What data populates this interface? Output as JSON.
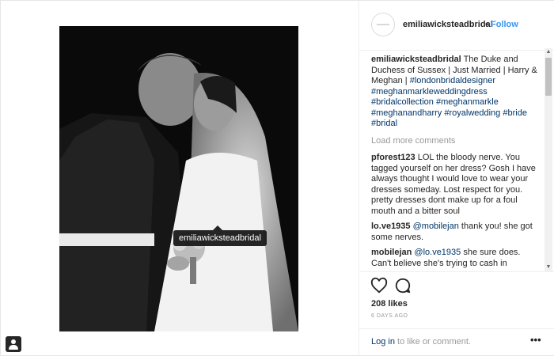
{
  "post": {
    "tag_label": "emiliawicksteadbridal",
    "username": "emiliawicksteadbridal",
    "follow_label": "Follow",
    "dot": "•",
    "caption": {
      "user": "emiliawicksteadbridal",
      "text": " The Duke and Duchess of Sussex | Just Married | Harry & Meghan | ",
      "hashtags": [
        "#londonbridaldesigner",
        "#meghanmarkleweddingdress",
        "#bridalcollection",
        "#meghanmarkle",
        "#meghanandharry",
        "#royalwedding",
        "#bride",
        "#bridal"
      ]
    },
    "load_more": "Load more comments",
    "comments": [
      {
        "user": "pforest123",
        "text": " LOL the bloody nerve. You tagged yourself on her dress? Gosh I have always thought I would love to wear your dresses someday. Lost respect for you. pretty dresses dont make up for a foul mouth and a bitter soul"
      },
      {
        "user": "lo.ve1935",
        "mention": "@mobilejan",
        "text": " thank you! she got some nerves."
      },
      {
        "user": "mobilejan",
        "mention": "@lo.ve1935",
        "text": " she sure does. Can't believe she's trying to cash in"
      }
    ],
    "likes": "208 likes",
    "date": "6 DAYS AGO",
    "login": {
      "link": "Log in",
      "rest": " to like or comment."
    },
    "more_options": "•••"
  }
}
